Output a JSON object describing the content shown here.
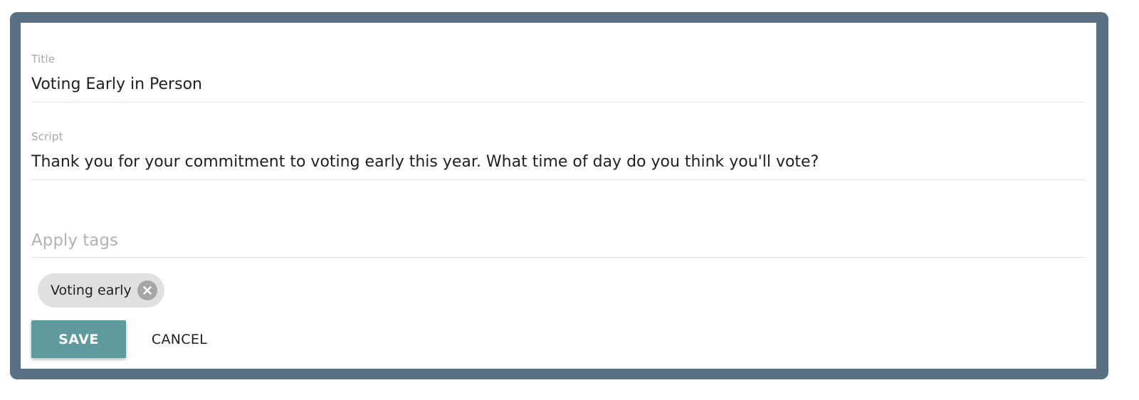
{
  "form": {
    "title_field": {
      "label": "Title",
      "value": "Voting Early in Person"
    },
    "script_field": {
      "label": "Script",
      "value": "Thank you for your commitment to voting early this year. What time of day do you think you'll vote?"
    },
    "tags_field": {
      "placeholder": "Apply tags",
      "value": ""
    },
    "tags": [
      {
        "label": "Voting early",
        "remove_icon": "close-circle-icon"
      }
    ],
    "actions": {
      "save_label": "SAVE",
      "cancel_label": "CANCEL"
    }
  },
  "colors": {
    "frame": "#587082",
    "save_button": "#5f9a9f",
    "chip_background": "#e0e0e0",
    "label_text": "#a8a8a8"
  }
}
